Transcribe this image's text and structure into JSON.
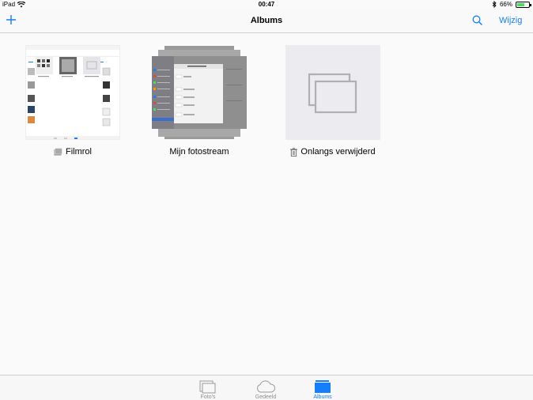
{
  "status_bar": {
    "device": "iPad",
    "time": "00:47",
    "battery": "66%",
    "battery_level": 0.66
  },
  "nav": {
    "title": "Albums",
    "add_icon": "plus-icon",
    "search_icon": "search-icon",
    "edit_label": "Wijzig"
  },
  "albums": [
    {
      "name": "Filmrol",
      "icon": "camera-roll-icon"
    },
    {
      "name": "Mijn fotostream",
      "icon": ""
    },
    {
      "name": "Onlangs verwijderd",
      "icon": "trash-icon"
    }
  ],
  "tabs": [
    {
      "label": "Foto's",
      "icon": "photos-icon",
      "active": false
    },
    {
      "label": "Gedeeld",
      "icon": "cloud-icon",
      "active": false
    },
    {
      "label": "Albums",
      "icon": "albums-icon",
      "active": true
    }
  ],
  "colors": {
    "accent": "#147efb",
    "battery": "#4cd964",
    "tab_inactive": "#8e8e93"
  }
}
